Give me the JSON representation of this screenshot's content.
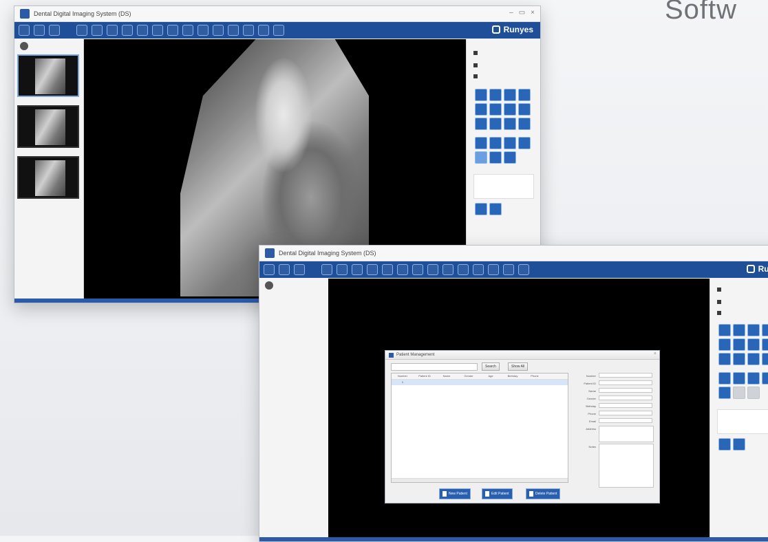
{
  "page": {
    "heading": "Softw"
  },
  "window1": {
    "title": "Dental Digital Imaging System (DS)",
    "brand": "Runyes",
    "thumbnail_labels": [
      "",
      "",
      ""
    ],
    "xray_label": ""
  },
  "window2": {
    "title": "Dental Digital Imaging System (DS)",
    "brand": "Runyes",
    "dialog": {
      "title": "Patient Management",
      "search_btn_1": "Search",
      "search_btn_2": "Show All",
      "table_headers": [
        "Number",
        "Patient ID",
        "Name",
        "Gender",
        "Age",
        "Birthday",
        "Phone"
      ],
      "table_rows": [
        {
          "cells": [
            "1",
            "",
            "",
            "",
            "",
            "",
            ""
          ]
        }
      ],
      "form_labels": [
        "Number",
        "Patient ID",
        "Name",
        "Gender",
        "Birthday",
        "Phone",
        "Email",
        "Address",
        "Notes"
      ],
      "buttons": [
        "New Patient",
        "Edit Patient",
        "Delete Patient"
      ]
    }
  },
  "colors": {
    "toolbar": "#1f4f99",
    "accent": "#2a66b8",
    "viewer": "#000000"
  }
}
